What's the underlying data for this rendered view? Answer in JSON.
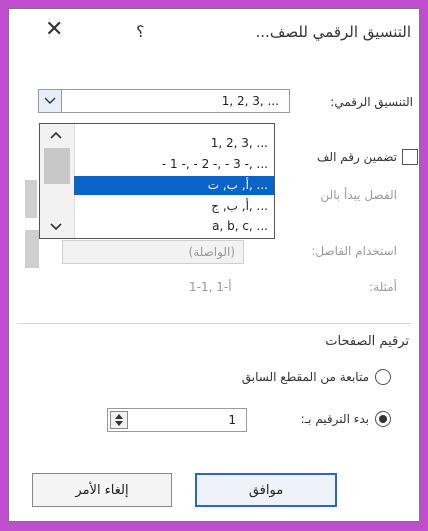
{
  "dialog": {
    "title": "التنسيق الرقمي للصف...",
    "help_label": "؟",
    "close_label": "✕"
  },
  "number_format": {
    "label": "التنسيق الرقمي:",
    "value": "1, 2, 3, ...",
    "options": [
      "1, 2, 3, ...",
      "- 1 -, - 2 -, - 3 -, ...",
      "أ, ب, ت, ...",
      "أ, ب, ج, ...",
      "a, b, c, ..."
    ],
    "selected_index": 2
  },
  "include_level": {
    "label": "تضمين رقم الف",
    "checked": false
  },
  "separator_start": {
    "label": "الفصل يبدأ بالن"
  },
  "use_separator": {
    "label": "استخدام الفاصل:",
    "value": "(الواصلة)"
  },
  "examples": {
    "label": "أمثلة:",
    "value": "1-1, 1-أ"
  },
  "page_numbering": {
    "heading": "ترقيم الصفحات",
    "continue_label": "متابعة من المقطع السابق",
    "continue_selected": false,
    "start_at_label": "بدء الترقيم بـ:",
    "start_at_selected": true,
    "start_at_value": "1"
  },
  "buttons": {
    "ok": "موافق",
    "cancel": "إلغاء الأمر"
  }
}
